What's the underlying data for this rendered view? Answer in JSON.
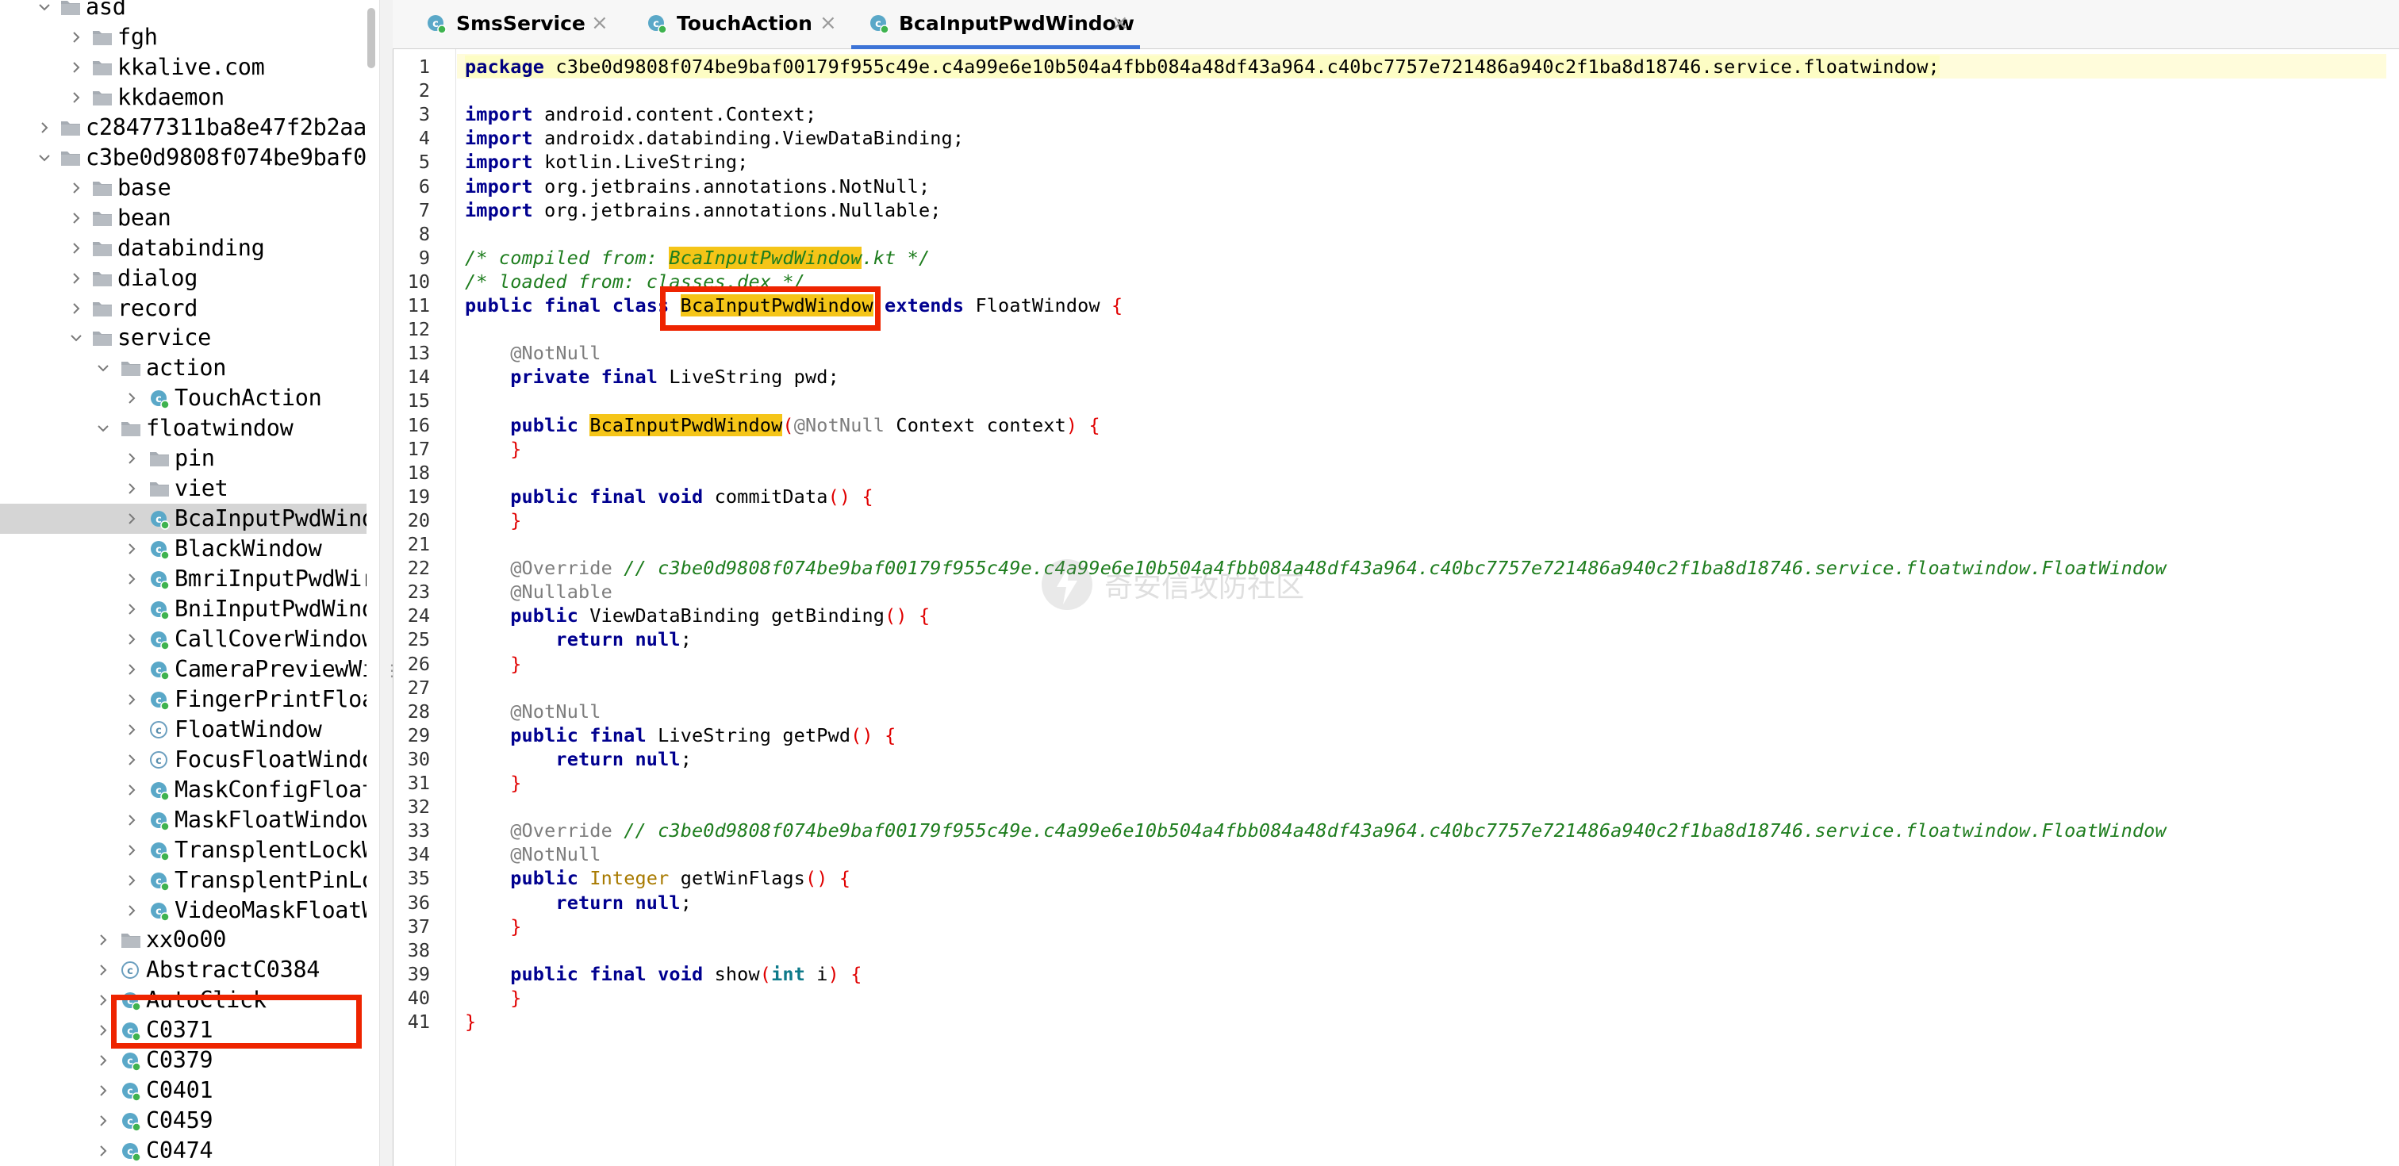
{
  "sidebar": {
    "rows": [
      {
        "label": "asd",
        "kind": "folder",
        "open": true
      },
      {
        "label": "fgh",
        "kind": "folder",
        "open": false
      },
      {
        "label": "kkalive.com",
        "kind": "folder",
        "open": false
      },
      {
        "label": "kkdaemon",
        "kind": "folder",
        "open": false
      },
      {
        "label": "c28477311ba8e47f2b2aa",
        "kind": "folder",
        "open": false
      },
      {
        "label": "c3be0d9808f074be9baf0",
        "kind": "folder",
        "open": true
      },
      {
        "label": "base",
        "kind": "folder",
        "open": false
      },
      {
        "label": "bean",
        "kind": "folder",
        "open": false
      },
      {
        "label": "databinding",
        "kind": "folder",
        "open": false
      },
      {
        "label": "dialog",
        "kind": "folder",
        "open": false
      },
      {
        "label": "record",
        "kind": "folder",
        "open": false
      },
      {
        "label": "service",
        "kind": "folder",
        "open": true
      },
      {
        "label": "action",
        "kind": "folder",
        "open": true
      },
      {
        "label": "TouchAction",
        "kind": "class",
        "open": false
      },
      {
        "label": "floatwindow",
        "kind": "folder",
        "open": true
      },
      {
        "label": "pin",
        "kind": "folder",
        "open": false
      },
      {
        "label": "viet",
        "kind": "folder",
        "open": false
      },
      {
        "label": "BcaInputPwdWind",
        "kind": "class",
        "open": false,
        "selected": true
      },
      {
        "label": "BlackWindow",
        "kind": "class",
        "open": false
      },
      {
        "label": "BmriInputPwdWir",
        "kind": "class",
        "open": false
      },
      {
        "label": "BniInputPwdWind",
        "kind": "class",
        "open": false
      },
      {
        "label": "CallCoverWindow",
        "kind": "class",
        "open": false
      },
      {
        "label": "CameraPreviewWi",
        "kind": "class",
        "open": false
      },
      {
        "label": "FingerPrintFloa",
        "kind": "class",
        "open": false
      },
      {
        "label": "FloatWindow",
        "kind": "abstract",
        "open": false
      },
      {
        "label": "FocusFloatWindo",
        "kind": "abstract",
        "open": false
      },
      {
        "label": "MaskConfigFloat",
        "kind": "class",
        "open": false
      },
      {
        "label": "MaskFloatWindow",
        "kind": "class",
        "open": false
      },
      {
        "label": "TransplentLockW",
        "kind": "class",
        "open": false
      },
      {
        "label": "TransplentPinLo",
        "kind": "class",
        "open": false
      },
      {
        "label": "VideoMaskFloatW",
        "kind": "class",
        "open": false
      },
      {
        "label": "xx0o00",
        "kind": "folder",
        "open": false
      },
      {
        "label": "AbstractC0384",
        "kind": "abstract",
        "open": false
      },
      {
        "label": "AutoClick",
        "kind": "class",
        "open": false
      },
      {
        "label": "C0371",
        "kind": "class",
        "open": false
      },
      {
        "label": "C0379",
        "kind": "class",
        "open": false
      },
      {
        "label": "C0401",
        "kind": "class",
        "open": false
      },
      {
        "label": "C0459",
        "kind": "class",
        "open": false
      },
      {
        "label": "C0474",
        "kind": "class",
        "open": false
      }
    ]
  },
  "tabs": [
    {
      "label": "SmsService",
      "active": false
    },
    {
      "label": "TouchAction",
      "active": false
    },
    {
      "label": "BcaInputPwdWindow",
      "active": true
    }
  ],
  "tab_close_glyph": "×",
  "editor": {
    "package_kw": "package",
    "package_name": "c3be0d9808f074be9baf00179f955c49e.c4a99e6e10b504a4fbb084a48df43a964.c40bc7757e721486a940c2f1ba8d18746.service.floatwindow;",
    "imports": [
      "android.content.Context;",
      "androidx.databinding.ViewDataBinding;",
      "kotlin.LiveString;",
      "org.jetbrains.annotations.NotNull;",
      "org.jetbrains.annotations.Nullable;"
    ],
    "import_kw": "import",
    "compiled_from_pre": "/* compiled from: ",
    "compiled_from_name": "BcaInputPwdWindow",
    "compiled_from_post": ".kt */",
    "loaded_from": "/* loaded from: classes.dex */",
    "class_decl_pre": "public final class ",
    "class_name": "BcaInputPwdWindow",
    "class_decl_extends": " extends ",
    "class_super": "FloatWindow",
    "open_brace": " {",
    "close_brace": "}",
    "notnull": "@NotNull",
    "nullable": "@Nullable",
    "override": "@Override",
    "field_kw": "private final",
    "field_rest": " LiveString pwd;",
    "ctor_kw": "public",
    "ctor_param_ann": "@NotNull",
    "ctor_param_rest": " Context context",
    "commit_kw": "public final void",
    "commit_rest": " commitData",
    "override_comment": "// c3be0d9808f074be9baf00179f955c49e.c4a99e6e10b504a4fbb084a48df43a964.c40bc7757e721486a940c2f1ba8d18746.service.floatwindow.FloatWindow",
    "getbinding_kw": "public",
    "getbinding_rest": " ViewDataBinding getBinding",
    "return_kw": "return",
    "null_kw": "null",
    "getpwd_kw": "public final",
    "getpwd_rest": " LiveString getPwd",
    "getwin_kw": "public",
    "getwin_type": "Integer",
    "getwin_rest": " getWinFlags",
    "show_kw": "public final void",
    "show_rest": " show",
    "show_param_type": "int",
    "show_param_name": " i",
    "line_count": 41
  },
  "watermark": "奇安信攻防社区",
  "colors": {
    "tab_underline": "#3d74d7",
    "highlight": "#f5c518",
    "red_box": "#ee2400",
    "class_icon": "#5aa8c8",
    "run_dot": "#3fb34f"
  }
}
